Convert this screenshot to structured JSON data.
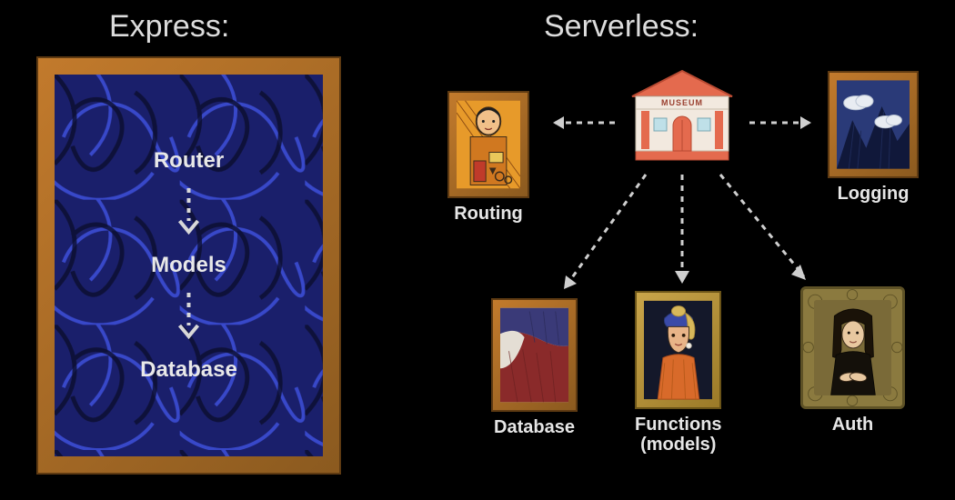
{
  "left": {
    "title": "Express:",
    "stack": [
      "Router",
      "Models",
      "Database"
    ]
  },
  "right": {
    "title": "Serverless:",
    "hub": {
      "label": "MUSEUM"
    },
    "nodes": {
      "routing": {
        "label": "Routing"
      },
      "logging": {
        "label": "Logging"
      },
      "database": {
        "label": "Database"
      },
      "functions": {
        "label": "Functions\n(models)"
      },
      "auth": {
        "label": "Auth"
      }
    }
  }
}
